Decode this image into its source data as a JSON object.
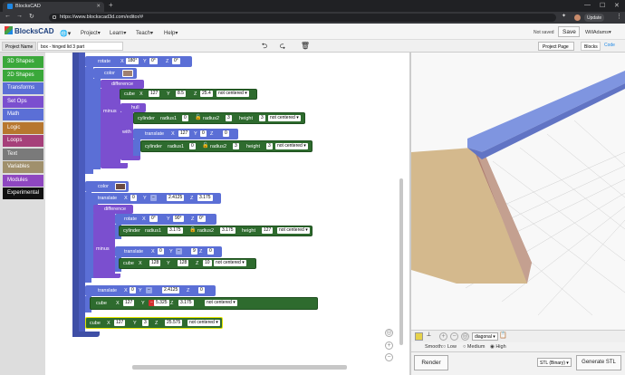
{
  "browser": {
    "tab_title": "BlocksCAD",
    "url": "https://www.blockscad3d.com/editor/#",
    "update_label": "Update",
    "new_tab": "+"
  },
  "app": {
    "logo": "BlocksCAD",
    "menu": [
      "Project",
      "Learn",
      "Teach",
      "Help"
    ],
    "status": "Not saved",
    "save_label": "Save",
    "user": "WillAdams"
  },
  "project": {
    "name_label": "Project Name",
    "name_value": "box - hinged lid 3 part",
    "project_page_label": "Project Page",
    "tab_blocks": "Blocks",
    "tab_code": "Code"
  },
  "categories": [
    {
      "label": "3D Shapes",
      "color": "#3aa83a"
    },
    {
      "label": "2D Shapes",
      "color": "#3aa83a"
    },
    {
      "label": "Transforms",
      "color": "#5b6fd6"
    },
    {
      "label": "Set Ops",
      "color": "#7b4fcf"
    },
    {
      "label": "Math",
      "color": "#5b6fd6"
    },
    {
      "label": "Logic",
      "color": "#b7772f"
    },
    {
      "label": "Loops",
      "color": "#a6407a"
    },
    {
      "label": "Text",
      "color": "#7a7a7a"
    },
    {
      "label": "Variables",
      "color": "#a0906c"
    },
    {
      "label": "Modules",
      "color": "#8e47c0"
    },
    {
      "label": "Experimental",
      "color": "#111111"
    }
  ],
  "blocks": {
    "rotate": {
      "label": "rotate",
      "x": "180°",
      "y": "0°",
      "z": "0°"
    },
    "color1": {
      "label": "color"
    },
    "difference1": {
      "label": "difference",
      "minus": "minus"
    },
    "cube1": {
      "label": "cube",
      "x": "127",
      "y": "8.5",
      "z": "25.4",
      "centered": "not centered"
    },
    "hull": {
      "label": "hull",
      "with": "with"
    },
    "cyl1": {
      "label": "cylinder",
      "r1": "0",
      "r2": "3",
      "h": "3",
      "centered": "not centered"
    },
    "translate1": {
      "label": "translate",
      "x": "127",
      "y": "0",
      "z": "0"
    },
    "cyl2": {
      "label": "cylinder",
      "r1": "0",
      "r2": "3",
      "h": "3",
      "centered": "not centered"
    },
    "color2": {
      "label": "color"
    },
    "translate2": {
      "label": "translate",
      "x": "0",
      "y": "−",
      "yval": "2.4125",
      "z": "3.175"
    },
    "difference2": {
      "label": "difference",
      "minus": "minus"
    },
    "rotate2": {
      "label": "rotate",
      "x": "0°",
      "y": "90°",
      "z": "0°"
    },
    "cyl3": {
      "label": "cylinder",
      "r1": "3.175",
      "r2": "3.175",
      "h": "127",
      "centered": "not centered"
    },
    "translate3": {
      "label": "translate",
      "x": "0",
      "y": "−",
      "yval": "9",
      "z": "0"
    },
    "cube2": {
      "label": "cube",
      "x": "128",
      "y": "128",
      "z": "10",
      "centered": "not centered"
    },
    "translate4": {
      "label": "translate",
      "x": "0",
      "y": "−",
      "yval": "2.4125",
      "z": "0"
    },
    "cube3": {
      "label": "cube",
      "x": "127",
      "y": "−",
      "yval": "5.325",
      "z": "3.175",
      "centered": "not centered"
    },
    "cube4": {
      "label": "cube",
      "x": "127",
      "y": "3",
      "z": "25.575",
      "centered": "not centered"
    }
  },
  "axis": {
    "x": "X",
    "y": "Y",
    "z": "Z",
    "radius1": "radius1",
    "radius2": "radius2",
    "height": "height"
  },
  "viewer": {
    "view_select": "diagonal",
    "smooth_label": "Smooth:",
    "smooth_options": [
      "Low",
      "Medium",
      "High"
    ],
    "smooth_selected": "High",
    "render_label": "Render",
    "format_select": "STL (Binary)",
    "generate_label": "Generate STL"
  },
  "colors": {
    "translate": "#5b6fd6",
    "setop": "#7b4fcf",
    "shape": "#2e6b2e",
    "outer": "#4455aa"
  }
}
